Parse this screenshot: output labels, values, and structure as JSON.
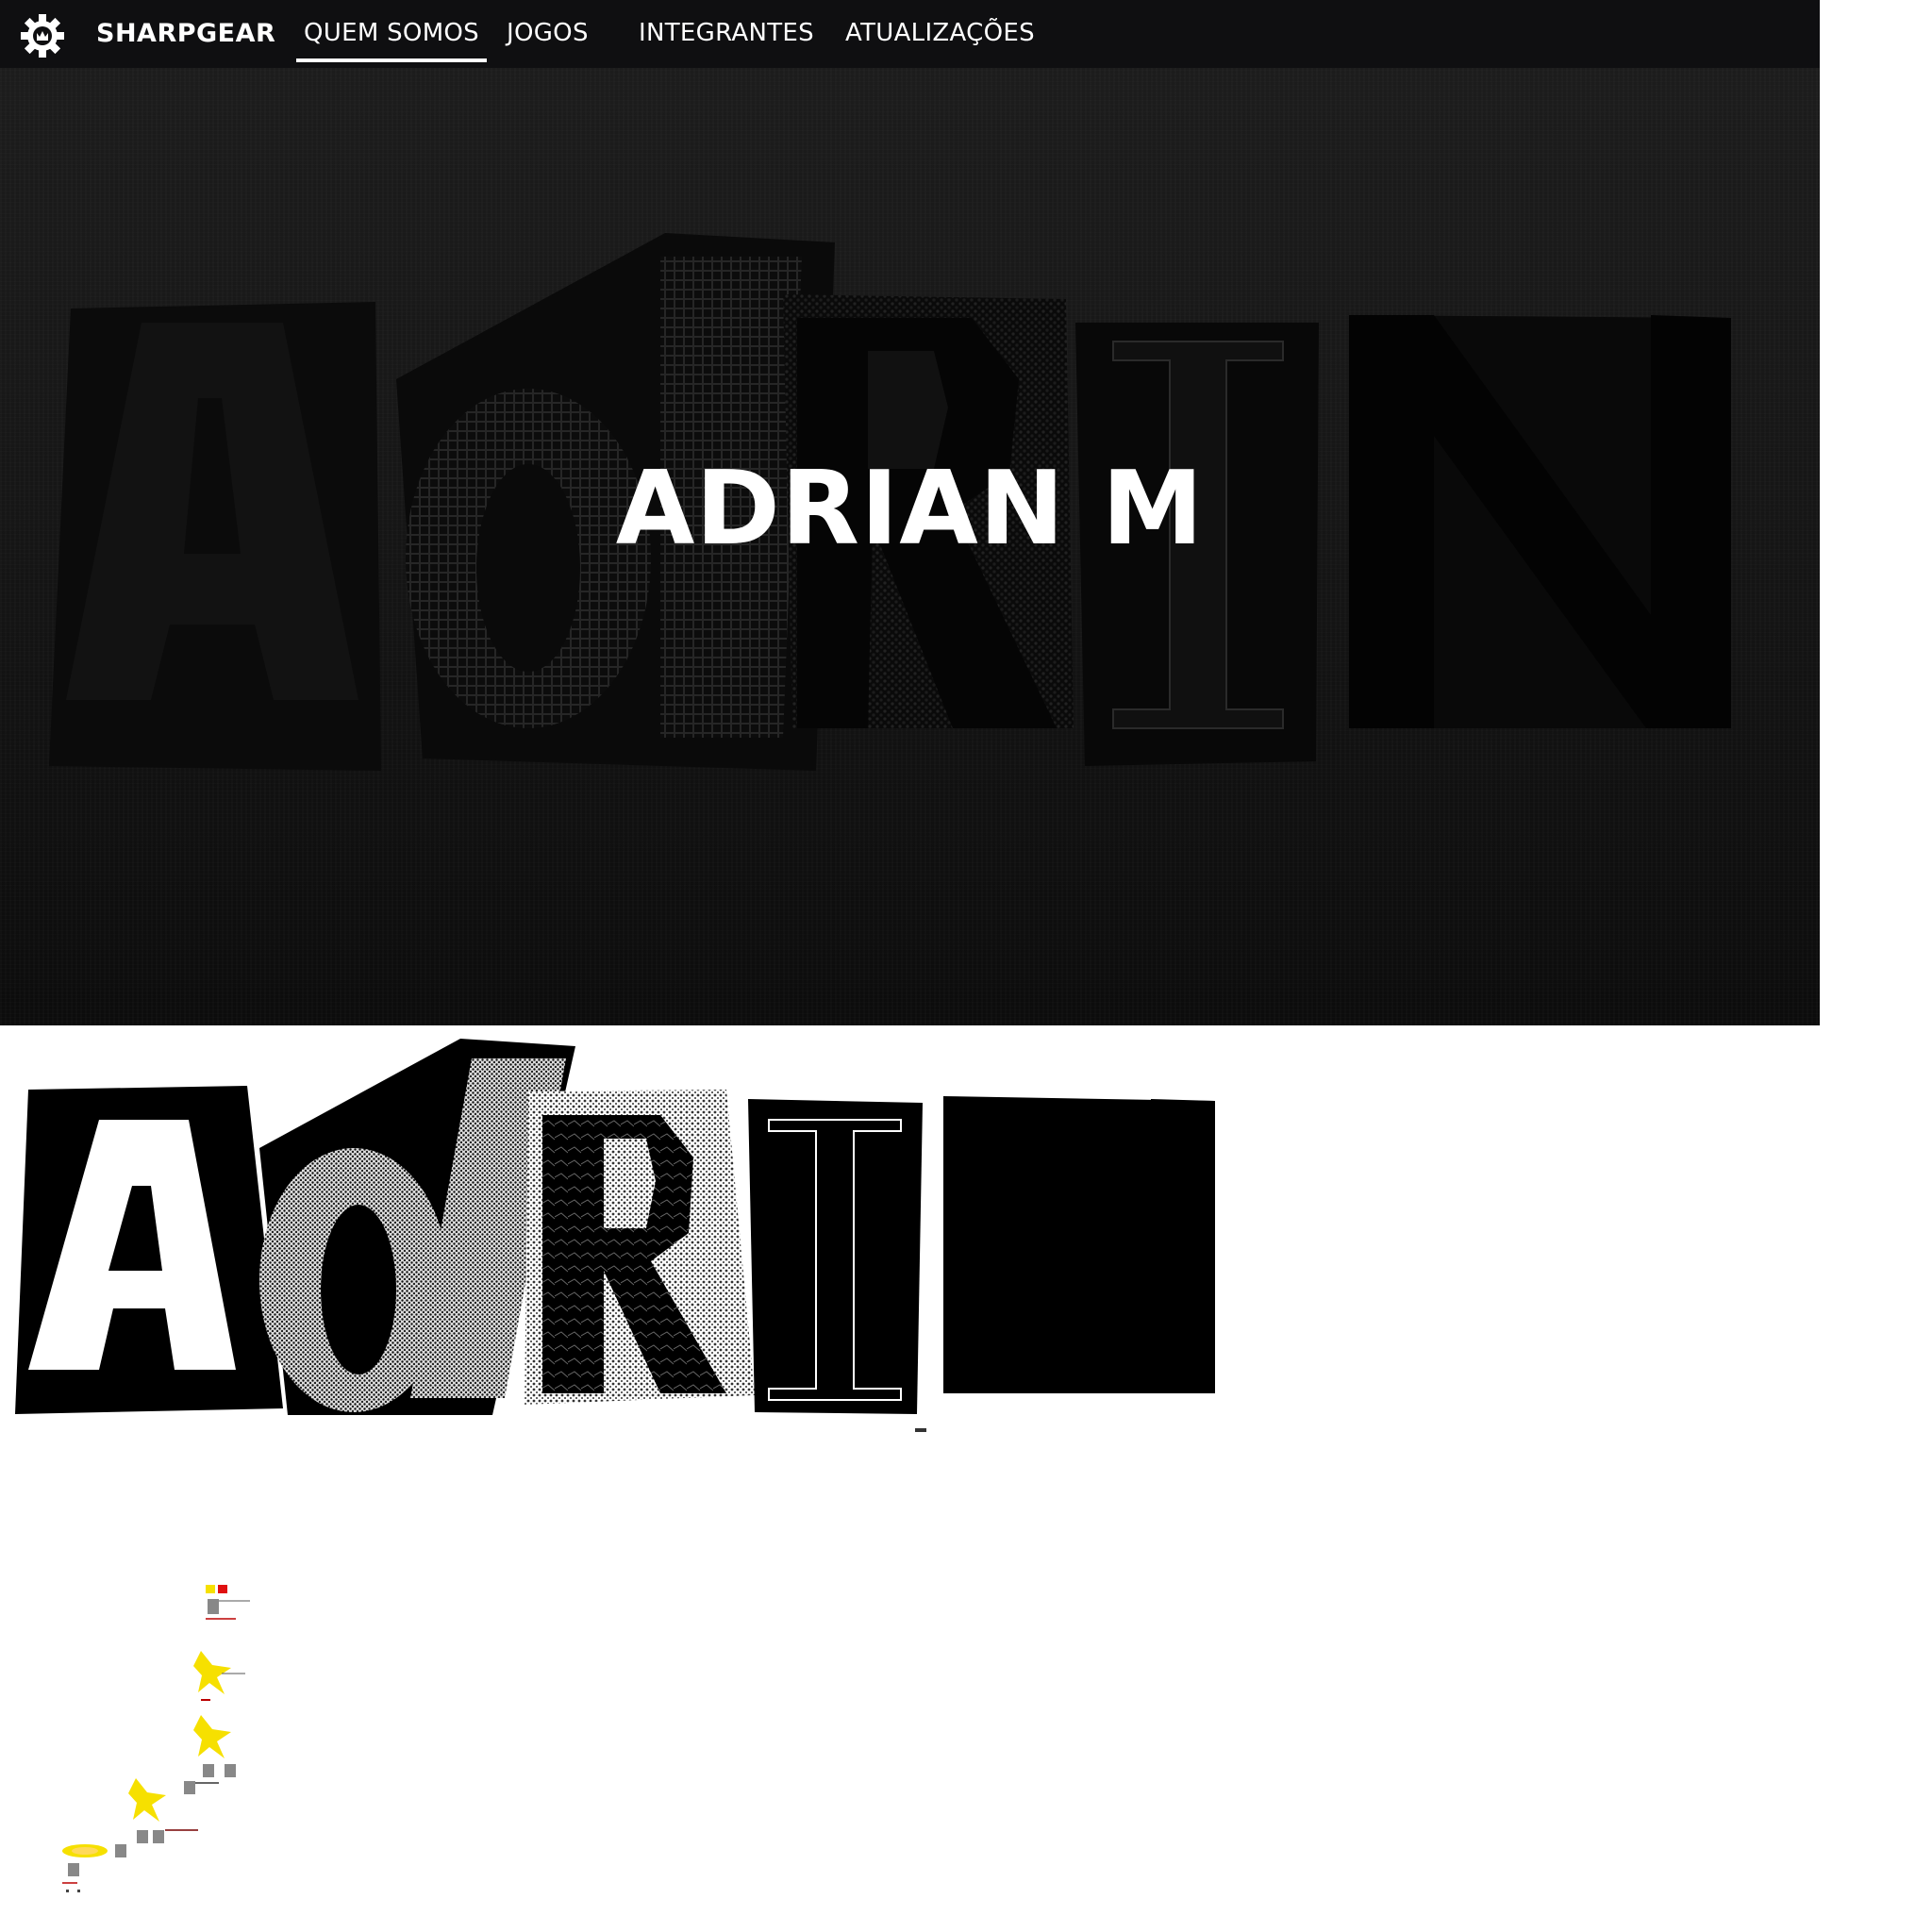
{
  "nav": {
    "brand": "SHARPGEAR",
    "links": [
      {
        "label": "QUEM SOMOS",
        "active": true
      },
      {
        "label": "JOGOS",
        "active": false
      },
      {
        "label": "INTEGRANTES",
        "active": false
      },
      {
        "label": "ATUALIZAÇÕES",
        "active": false
      }
    ]
  },
  "hero": {
    "title": "ADRIAN M"
  },
  "colors": {
    "nav_bg": "#0f0f11",
    "hero_bg": "#161616",
    "accent": "#ffffff",
    "pixel_yellow": "#f6e000",
    "pixel_red": "#e01010"
  },
  "icons": [
    "gear-logo-icon",
    "gear-and-sprite-diagram"
  ]
}
